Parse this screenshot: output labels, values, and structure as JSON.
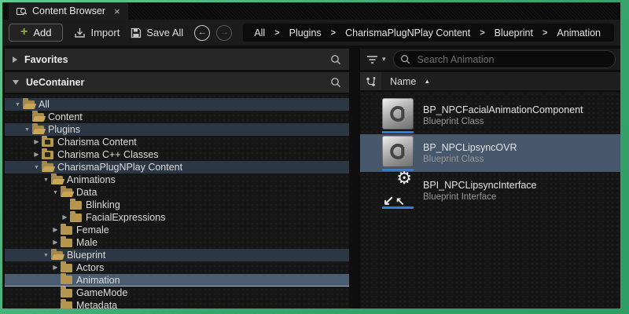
{
  "window": {
    "tab_title": "Content Browser",
    "close_icon": "×"
  },
  "toolbar": {
    "add_label": "Add",
    "import_label": "Import",
    "save_all_label": "Save All",
    "back_icon": "←",
    "forward_icon": "→",
    "breadcrumb": [
      "All",
      "Plugins",
      "CharismaPlugNPlay Content",
      "Blueprint",
      "Animation"
    ],
    "breadcrumb_separator": ">"
  },
  "left_panel": {
    "favorites_label": "Favorites",
    "container_label": "UeContainer",
    "tree": [
      {
        "label": "All",
        "level": 0,
        "expander": "down",
        "icon": "folder-open",
        "state": "path"
      },
      {
        "label": "Content",
        "level": 1,
        "expander": "none",
        "icon": "folder-open",
        "state": "none"
      },
      {
        "label": "Plugins",
        "level": 1,
        "expander": "down",
        "icon": "folder-open",
        "state": "path"
      },
      {
        "label": "Charisma Content",
        "level": 2,
        "expander": "right",
        "icon": "folder-plugin",
        "state": "none"
      },
      {
        "label": "Charisma C++ Classes",
        "level": 2,
        "expander": "right",
        "icon": "folder-plugin",
        "state": "none"
      },
      {
        "label": "CharismaPlugNPlay Content",
        "level": 2,
        "expander": "down",
        "icon": "folder-open",
        "state": "path"
      },
      {
        "label": "Animations",
        "level": 3,
        "expander": "down",
        "icon": "folder-open",
        "state": "none"
      },
      {
        "label": "Data",
        "level": 4,
        "expander": "down",
        "icon": "folder-open",
        "state": "none"
      },
      {
        "label": "Blinking",
        "level": 5,
        "expander": "none",
        "icon": "folder-closed",
        "state": "none"
      },
      {
        "label": "FacialExpressions",
        "level": 5,
        "expander": "right",
        "icon": "folder-closed",
        "state": "none"
      },
      {
        "label": "Female",
        "level": 4,
        "expander": "right",
        "icon": "folder-closed",
        "state": "none"
      },
      {
        "label": "Male",
        "level": 4,
        "expander": "right",
        "icon": "folder-closed",
        "state": "none"
      },
      {
        "label": "Blueprint",
        "level": 3,
        "expander": "down",
        "icon": "folder-open",
        "state": "path"
      },
      {
        "label": "Actors",
        "level": 4,
        "expander": "right",
        "icon": "folder-closed",
        "state": "none"
      },
      {
        "label": "Animation",
        "level": 4,
        "expander": "none",
        "icon": "folder-closed",
        "state": "selected"
      },
      {
        "label": "GameMode",
        "level": 4,
        "expander": "none",
        "icon": "folder-closed",
        "state": "none"
      },
      {
        "label": "Metadata",
        "level": 4,
        "expander": "none",
        "icon": "folder-closed",
        "state": "none"
      }
    ]
  },
  "right_panel": {
    "search_placeholder": "Search Animation",
    "name_header": "Name",
    "sort_indicator": "▲",
    "assets": [
      {
        "name": "BP_NPCFacialAnimationComponent",
        "type": "Blueprint Class",
        "icon": "charisma-blueprint",
        "selected": false
      },
      {
        "name": "BP_NPCLipsyncOVR",
        "type": "Blueprint Class",
        "icon": "charisma-blueprint",
        "selected": true
      },
      {
        "name": "BPI_NPCLipsyncInterface",
        "type": "Blueprint Interface",
        "icon": "blueprint-interface",
        "selected": false
      }
    ]
  },
  "icons": {
    "expanded": "▼",
    "collapsed": "▶",
    "plus": "+",
    "gear": "⚙",
    "arrow_sw": "↙",
    "arrow_nw": "↖",
    "chevron_down": "▾"
  },
  "colors": {
    "frame_green": "#3fae73",
    "accent_blue": "#2e7ce0",
    "selection_blue_gray": "#4a5c70",
    "path_highlight": "#2c3745",
    "folder_gold": "#b6954d",
    "add_plus_green": "#8ab23f"
  }
}
